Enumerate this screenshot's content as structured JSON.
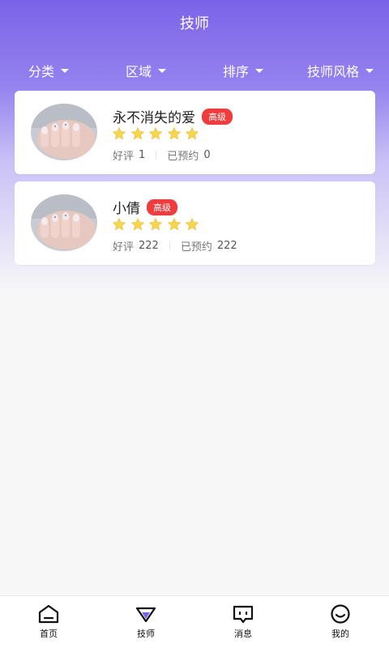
{
  "header": {
    "title": "技师"
  },
  "filters": [
    {
      "label": "分类"
    },
    {
      "label": "区域"
    },
    {
      "label": "排序"
    },
    {
      "label": "技师风格"
    }
  ],
  "technicians": [
    {
      "name": "永不消失的爱",
      "level": "高级",
      "rating": 5,
      "good_reviews_label": "好评",
      "good_reviews": "1",
      "booked_label": "已预约",
      "booked": "0",
      "avatar_icon": "nail-photo"
    },
    {
      "name": "小倩",
      "level": "高级",
      "rating": 5,
      "good_reviews_label": "好评",
      "good_reviews": "222",
      "booked_label": "已预约",
      "booked": "222",
      "avatar_icon": "nail-photo"
    }
  ],
  "tabbar": {
    "home": {
      "label": "首页",
      "icon": "home-icon"
    },
    "technicians": {
      "label": "技师",
      "icon": "diamond-icon",
      "active": true
    },
    "messages": {
      "label": "消息",
      "icon": "chat-icon"
    },
    "mine": {
      "label": "我的",
      "icon": "smile-icon"
    }
  },
  "colors": {
    "accent": "#7b63e8",
    "badge": "#f03c3c",
    "star": "#f7d64a"
  }
}
